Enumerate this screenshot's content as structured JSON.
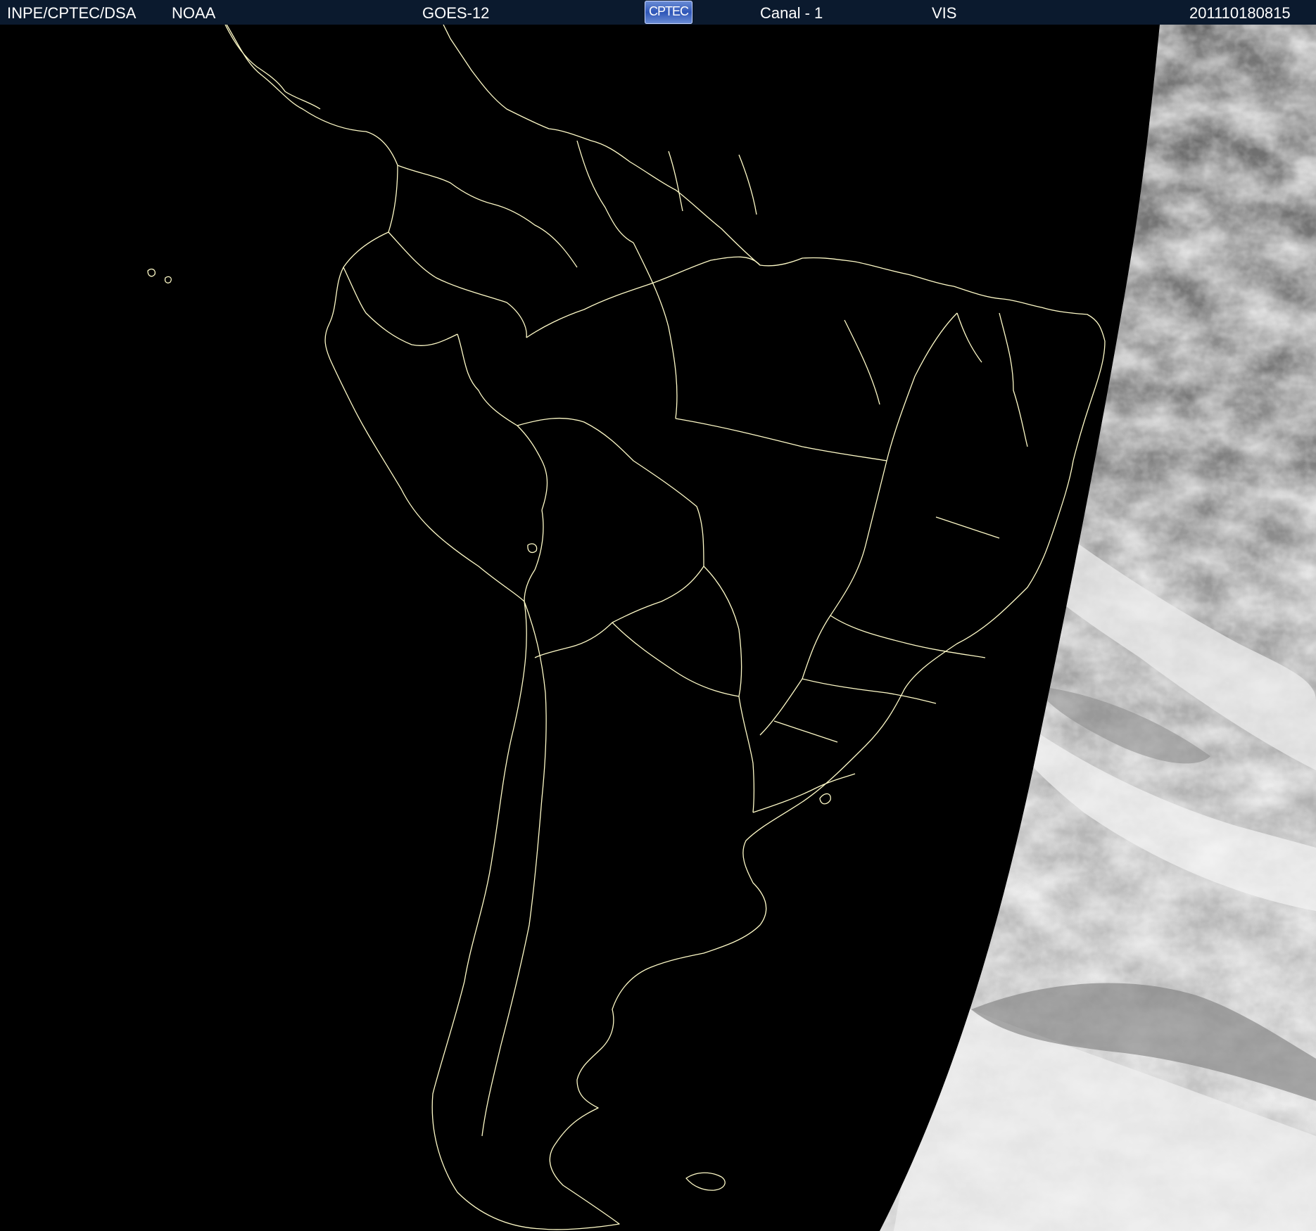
{
  "header": {
    "agency": "INPE/CPTEC/DSA",
    "provider": "NOAA",
    "satellite": "GOES-12",
    "logo_text": "CPTEC",
    "channel": "Canal - 1",
    "band": "VIS",
    "timestamp": "201110180815"
  },
  "colors": {
    "header_background": "#0b1a2e",
    "space_background": "#000000",
    "boundary_lines": "#fffbc8",
    "cloud_white": "#f2f2f2",
    "cloud_gray": "#7a7a7a"
  }
}
